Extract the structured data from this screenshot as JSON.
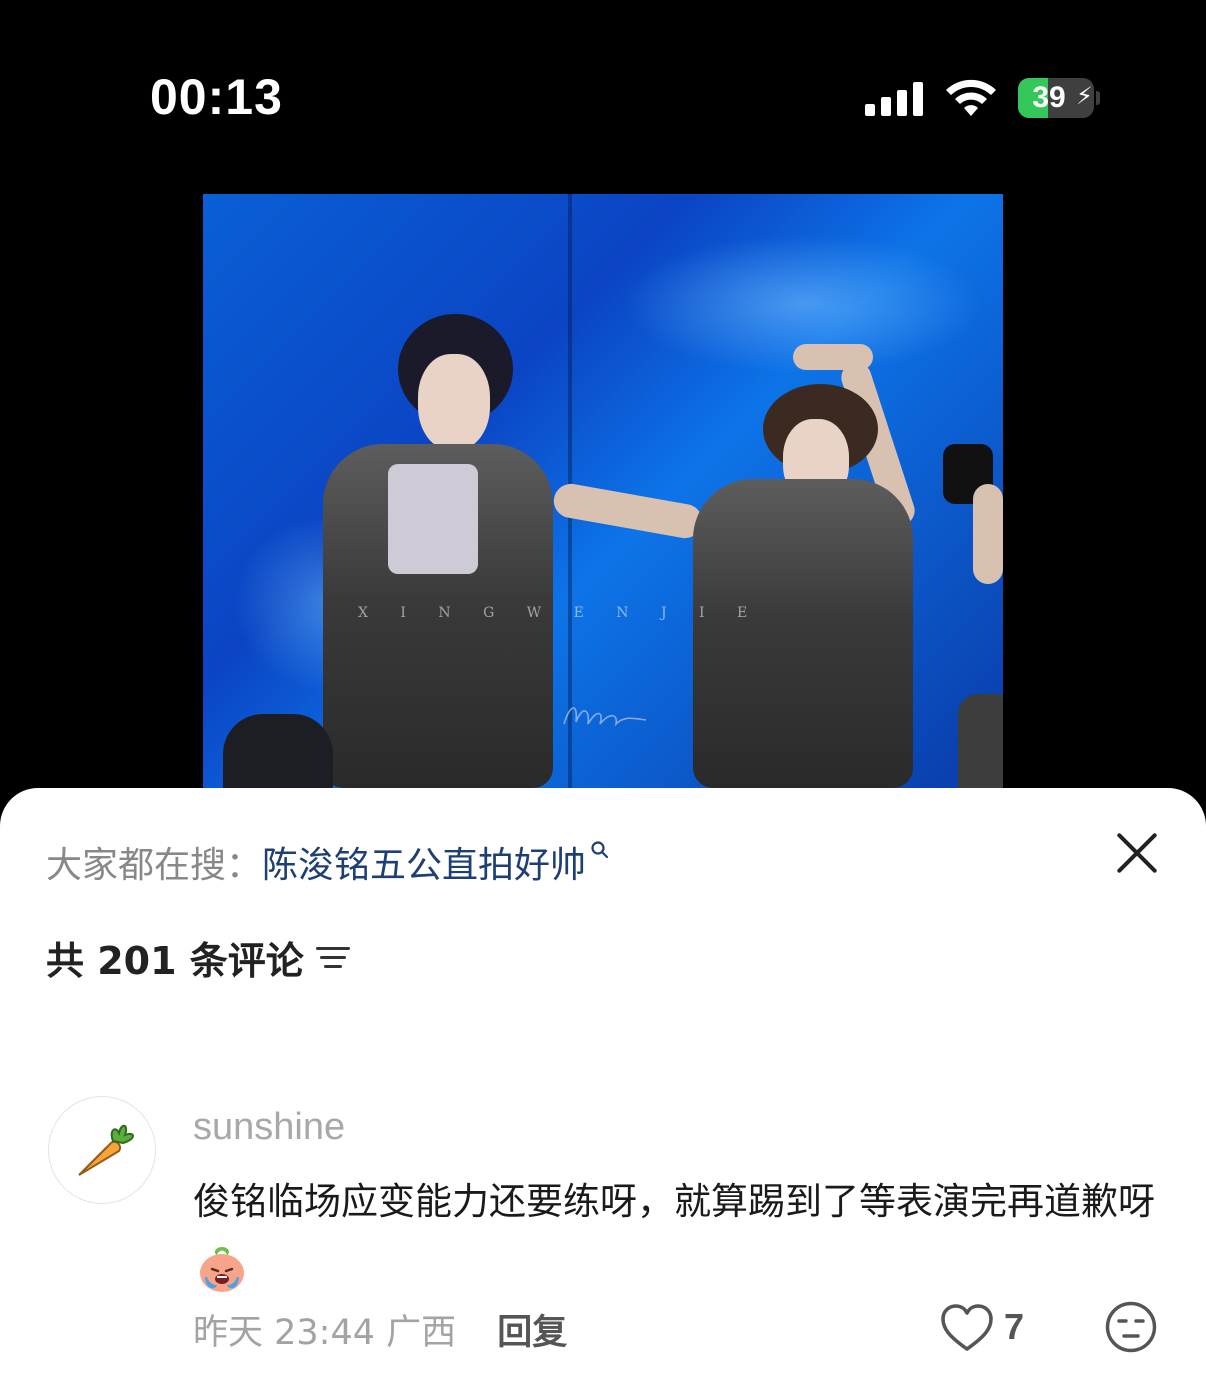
{
  "status_bar": {
    "time": "00:13",
    "battery_percent": "39",
    "battery_level": 0.39,
    "charging": true,
    "signal_bars": 4,
    "colors": {
      "battery_fill": "#34c759"
    }
  },
  "media": {
    "watermark_text": "X I N G W E N J I E",
    "signature_present": true
  },
  "comments_panel": {
    "search_hint": {
      "prefix": "大家都在搜：",
      "query": "陈浚铭五公直拍好帅",
      "icon": "search-icon"
    },
    "close_icon": "close-icon",
    "count_label": "共 201 条评论",
    "sort_icon": "sort-icon",
    "comments": [
      {
        "username": "sunshine",
        "avatar_icon": "carrot-icon",
        "text": "俊铭临场应变能力还要练呀，就算踢到了等表演完再道歉呀",
        "emoji": "crying-peach-emoji",
        "time": "昨天 23:44",
        "location": "广西",
        "reply_label": "回复",
        "like_count": "7",
        "like_icon": "heart-icon",
        "react_icon": "emoji-face-icon"
      }
    ]
  },
  "colors": {
    "query_link": "#1d3f73",
    "muted_text": "#a3a3a3",
    "body_text": "#1a1a1a"
  }
}
